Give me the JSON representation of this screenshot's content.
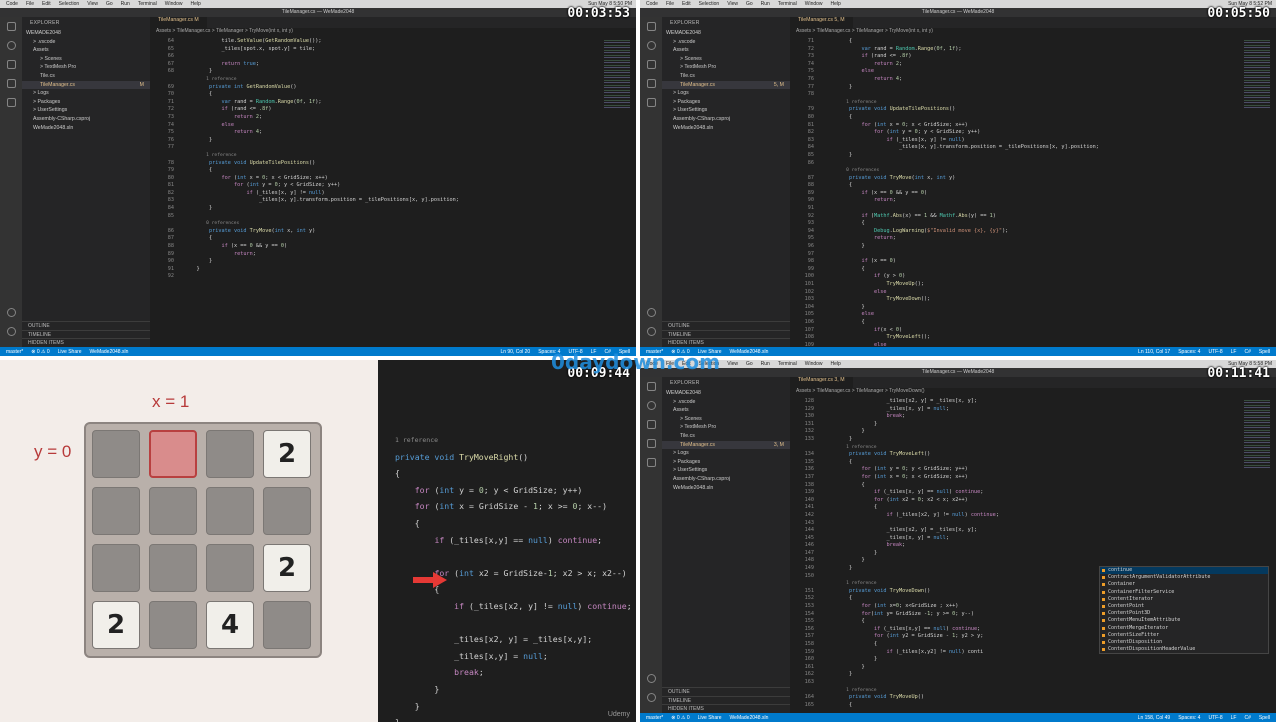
{
  "q1": {
    "timer": "00:03:53",
    "menu": [
      "Code",
      "File",
      "Edit",
      "Selection",
      "View",
      "Go",
      "Run",
      "Terminal",
      "Window",
      "Help"
    ],
    "clock": "Sun May 8 5:50 PM",
    "window_title": "TileManager.cs — WeMade2048",
    "explorer": {
      "title": "EXPLORER",
      "rows": [
        {
          "label": "WEMADE2048",
          "indent": 0
        },
        {
          "label": "> .vscode",
          "indent": 1
        },
        {
          "label": "Assets",
          "indent": 1
        },
        {
          "label": "> Scenes",
          "indent": 2
        },
        {
          "label": "> TextMesh Pro",
          "indent": 2
        },
        {
          "label": "Tile.cs",
          "indent": 2
        },
        {
          "label": "TileManager.cs",
          "indent": 2,
          "mark": "M",
          "selected": true
        },
        {
          "label": "> Logs",
          "indent": 1
        },
        {
          "label": "> Packages",
          "indent": 1
        },
        {
          "label": "> UserSettings",
          "indent": 1
        },
        {
          "label": "Assembly-CSharp.csproj",
          "indent": 1
        },
        {
          "label": "WeMade2048.sln",
          "indent": 1
        }
      ],
      "footer": [
        "OUTLINE",
        "TIMELINE",
        "HIDDEN ITEMS"
      ]
    },
    "tab": "TileManager.cs M",
    "breadcrumb": "Assets > TileManager.cs > TileManager > TryMove(int x, int y)",
    "status_left": [
      "master*",
      "⊗ 0 ⚠ 0",
      "Live Share",
      "WeMade2048.sln"
    ],
    "status_right": [
      "Ln 90, Col 20",
      "Spaces: 4",
      "UTF-8",
      "LF",
      "C#",
      "Spell"
    ]
  },
  "q2": {
    "timer": "00:05:50",
    "clock": "Sun May 8 5:52 PM",
    "window_title": "TileManager.cs — WeMade2048",
    "explorer": {
      "title": "EXPLORER",
      "rows": [
        {
          "label": "WEMADE2048",
          "indent": 0
        },
        {
          "label": "> .vscode",
          "indent": 1
        },
        {
          "label": "Assets",
          "indent": 1
        },
        {
          "label": "> Scenes",
          "indent": 2
        },
        {
          "label": "> TextMesh Pro",
          "indent": 2
        },
        {
          "label": "Tile.cs",
          "indent": 2
        },
        {
          "label": "TileManager.cs",
          "indent": 2,
          "mark": "5, M",
          "selected": true
        },
        {
          "label": "> Logs",
          "indent": 1
        },
        {
          "label": "> Packages",
          "indent": 1
        },
        {
          "label": "> UserSettings",
          "indent": 1
        },
        {
          "label": "Assembly-CSharp.csproj",
          "indent": 1
        },
        {
          "label": "WeMade2048.sln",
          "indent": 1
        }
      ],
      "footer": [
        "OUTLINE",
        "TIMELINE",
        "HIDDEN ITEMS"
      ]
    },
    "tab": "TileManager.cs 5, M",
    "breadcrumb": "Assets > TileManager.cs > TileManager > TryMove(int x, int y)",
    "status_left": [
      "master*",
      "⊗ 0 ⚠ 0",
      "Live Share",
      "WeMade2048.sln"
    ],
    "status_right": [
      "Ln 110, Col 17",
      "Spaces: 4",
      "UTF-8",
      "LF",
      "C#",
      "Spell"
    ]
  },
  "q3": {
    "timer": "00:09:44",
    "x_label": "x = 1",
    "y_label": "y = 0",
    "tiles": [
      {
        "row": 0,
        "col": 3,
        "value": "2"
      },
      {
        "row": 2,
        "col": 3,
        "value": "2"
      },
      {
        "row": 3,
        "col": 0,
        "value": "2"
      },
      {
        "row": 3,
        "col": 2,
        "value": "4"
      }
    ],
    "highlight": {
      "row": 0,
      "col": 1
    },
    "watermark": "0daydown.com",
    "brand": "Udemy"
  },
  "q4": {
    "timer": "00:11:41",
    "clock": "Sun May 8 5:58 PM",
    "window_title": "TileManager.cs — WeMade2048",
    "explorer": {
      "title": "EXPLORER",
      "rows": [
        {
          "label": "WEMADE2048",
          "indent": 0
        },
        {
          "label": "> .vscode",
          "indent": 1
        },
        {
          "label": "Assets",
          "indent": 1
        },
        {
          "label": "> Scenes",
          "indent": 2
        },
        {
          "label": "> TextMesh Pro",
          "indent": 2
        },
        {
          "label": "Tile.cs",
          "indent": 2
        },
        {
          "label": "TileManager.cs",
          "indent": 2,
          "mark": "3, M",
          "selected": true
        },
        {
          "label": "> Logs",
          "indent": 1
        },
        {
          "label": "> Packages",
          "indent": 1
        },
        {
          "label": "> UserSettings",
          "indent": 1
        },
        {
          "label": "Assembly-CSharp.csproj",
          "indent": 1
        },
        {
          "label": "WeMade2048.sln",
          "indent": 1
        }
      ],
      "footer": [
        "OUTLINE",
        "TIMELINE",
        "HIDDEN ITEMS"
      ]
    },
    "tab": "TileManager.cs 3, M",
    "breadcrumb": "Assets > TileManager.cs > TileManager > TryMoveDown()",
    "suggestions": [
      "continue",
      "ContractArgumentValidatorAttribute",
      "Container",
      "ContainerFilterService",
      "ContentIterator",
      "ContentPoint",
      "ContentPoint3D",
      "ContentMenuItemAttribute",
      "ContentMergeIterator",
      "ContentSizeFitter",
      "ContentDisposition",
      "ContentDispositionHeaderValue"
    ],
    "status_left": [
      "master*",
      "⊗ 0 ⚠ 0",
      "Live Share",
      "WeMade2048.sln"
    ],
    "status_right": [
      "Ln 158, Col 49",
      "Spaces: 4",
      "UTF-8",
      "LF",
      "C#",
      "Spell"
    ]
  }
}
